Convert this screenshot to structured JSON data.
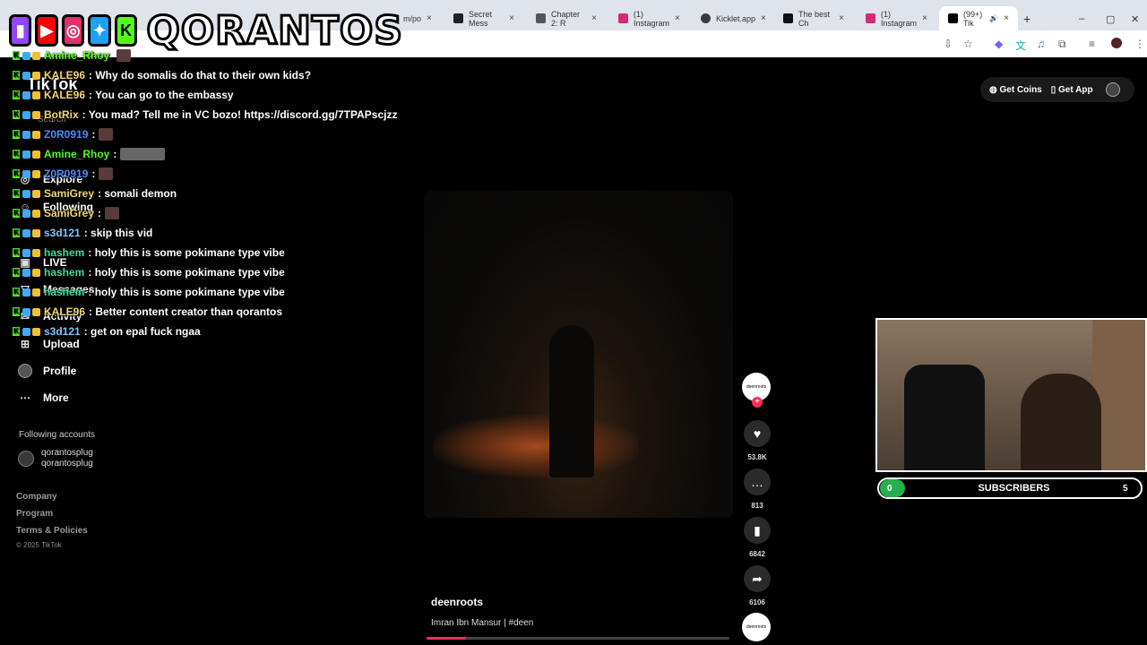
{
  "browser": {
    "tabs": [
      {
        "label": "m/po",
        "color": "#888888"
      },
      {
        "label": "Secret Mess",
        "color": "#222222"
      },
      {
        "label": "Chapter 2: R",
        "color": "#555555"
      },
      {
        "label": "(1) Instagram",
        "color": "#d62976"
      },
      {
        "label": "Kicklet.app",
        "color": "#3a3a3a"
      },
      {
        "label": "The best Ch",
        "color": "#111111"
      },
      {
        "label": "(1) Instagram",
        "color": "#d62976"
      },
      {
        "label": "(99+) Tik",
        "color": "#000000"
      }
    ],
    "close_glyph": "×",
    "newtab_glyph": "+",
    "window_controls": [
      "–",
      "▢",
      "✕"
    ]
  },
  "logo": {
    "text": "QORANTOS",
    "socials": [
      "twitch-icon",
      "youtube-icon",
      "instagram-icon",
      "twitter-icon",
      "kick-icon"
    ]
  },
  "tiktok": {
    "brand": "TikTok",
    "search_hint": "Search",
    "nav": {
      "explore": "Explore",
      "following": "Following",
      "live": "LIVE",
      "messages": "Messages",
      "activity": "Activity",
      "upload": "Upload",
      "profile": "Profile",
      "more": "More"
    },
    "following_accounts_title": "Following accounts",
    "following_account": {
      "username": "qorantosplug",
      "display": "qorantosplug"
    },
    "footer": {
      "company": "Company",
      "program": "Program",
      "terms": "Terms & Policies",
      "copyright": "© 2025 TikTok"
    },
    "top_actions": {
      "coins": "Get Coins",
      "app": "Get App"
    },
    "video": {
      "author": "deenroots",
      "caption": "Imran Ibn Mansur | #deen",
      "avatar_label": "deenroots",
      "likes": "53.8K",
      "comments": "813",
      "saves": "6842",
      "shares": "6106",
      "progress_percent": 13
    }
  },
  "chat": [
    {
      "user": "Amine_Rhoy",
      "color": "#53fc18",
      "msg": ""
    },
    {
      "user": "KALE96",
      "color": "#f5d76e",
      "msg": ": Why do somalis do that to their own kids?"
    },
    {
      "user": "KALE96",
      "color": "#f5d76e",
      "msg": ": You can go to the embassy"
    },
    {
      "user": "BotRix",
      "color": "#f5d76e",
      "msg": ": You mad? Tell me in VC bozo! https://discord.gg/7TPAPscjzz"
    },
    {
      "user": "Z0R0919",
      "color": "#4f8cff",
      "msg": ":"
    },
    {
      "user": "Amine_Rhoy",
      "color": "#53fc18",
      "msg": ":"
    },
    {
      "user": "Z0R0919",
      "color": "#4f8cff",
      "msg": ":"
    },
    {
      "user": "SamiGrey",
      "color": "#f5d76e",
      "msg": ": somali demon"
    },
    {
      "user": "SamiGrey",
      "color": "#f5d76e",
      "msg": ":"
    },
    {
      "user": "s3d121",
      "color": "#7ec8ff",
      "msg": ": skip this vid"
    },
    {
      "user": "hashem",
      "color": "#3ddc97",
      "msg": ": holy this is some pokimane type vibe"
    },
    {
      "user": "hashem",
      "color": "#3ddc97",
      "msg": ": holy this is some pokimane type vibe"
    },
    {
      "user": "hashem",
      "color": "#3ddc97",
      "msg": ": holy this is some pokimane type vibe"
    },
    {
      "user": "KALE96",
      "color": "#f5d76e",
      "msg": ": Better content creator than qorantos"
    },
    {
      "user": "s3d121",
      "color": "#7ec8ff",
      "msg": ": get on epal fuck ngaa"
    }
  ],
  "subs": {
    "label": "SUBSCRIBERS",
    "current": "0",
    "goal": "5"
  }
}
